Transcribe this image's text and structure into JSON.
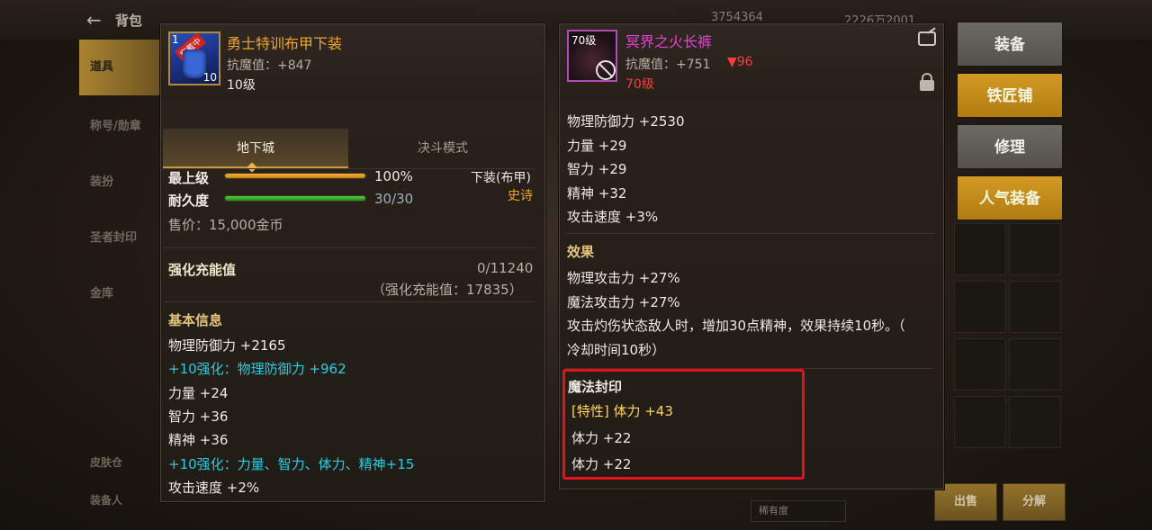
{
  "background": {
    "title": "背包",
    "currency_a": "3754364",
    "currency_b": "2226万2001",
    "sidebar": [
      "道具",
      "称号/勋章",
      "装扮",
      "圣者封印",
      "金库"
    ],
    "bottom_tabs": [
      "皮肤仓",
      "装备人"
    ],
    "sort_dropdown": "稀有度",
    "sell_button": "出售",
    "decompose_button": "分解"
  },
  "menu": {
    "equip": "装备",
    "blacksmith": "铁匠铺",
    "repair": "修理",
    "popular": "人气装备"
  },
  "left_item": {
    "badge": "穿戴中",
    "icon_level": "1",
    "icon_count": "10",
    "name": "勇士特训布甲下装",
    "magic_resist": "抗魔值：+847",
    "level": "10级",
    "tabs": [
      "地下城",
      "决斗模式"
    ],
    "active_tab": 0,
    "grade_label": "最上级",
    "grade_value": "100%",
    "grade_percent": 100,
    "durability_label": "耐久度",
    "durability_value": "30/30",
    "durability_percent": 100,
    "slot": "下装(布甲)",
    "rarity": "史诗",
    "sell_price": "售价：15,000金币",
    "charge_label": "强化充能值",
    "charge_value": "0/11240",
    "charge_note": "（强化充能值：17835）",
    "basic_info_title": "基本信息",
    "stats": [
      {
        "text": "物理防御力 +2165",
        "color": "white"
      },
      {
        "text": "+10强化：物理防御力 +962",
        "color": "cyan"
      },
      {
        "text": "力量 +24",
        "color": "white"
      },
      {
        "text": "智力 +36",
        "color": "white"
      },
      {
        "text": "精神 +36",
        "color": "white"
      },
      {
        "text": "+10强化：力量、智力、体力、精神+15",
        "color": "cyan"
      },
      {
        "text": "攻击速度 +2%",
        "color": "white"
      }
    ]
  },
  "right_item": {
    "icon_level": "70级",
    "name": "冥界之火长裤",
    "magic_resist": "抗魔值：+751",
    "resist_diff": "▼96",
    "level": "70级",
    "stats": [
      "物理防御力 +2530",
      "力量 +29",
      "智力 +29",
      "精神 +32",
      "攻击速度 +3%"
    ],
    "effect_title": "效果",
    "effects": [
      "物理攻击力 +27%",
      "魔法攻击力 +27%",
      "攻击灼伤状态敌人时，增加30点精神，效果持续10秒。（",
      "冷却时间10秒）"
    ],
    "seal_title": "魔法封印",
    "seal_trait": "[特性] 体力 +43",
    "seal_lines": [
      "体力 +22",
      "体力 +22"
    ]
  },
  "colors": {
    "title_orange": "#f0a52a",
    "title_magenta": "#e83fd7",
    "cyan": "#21cfe6",
    "highlight_red": "#e8111a",
    "menu_gold": "#c48b1a",
    "menu_gray": "#605d59"
  }
}
